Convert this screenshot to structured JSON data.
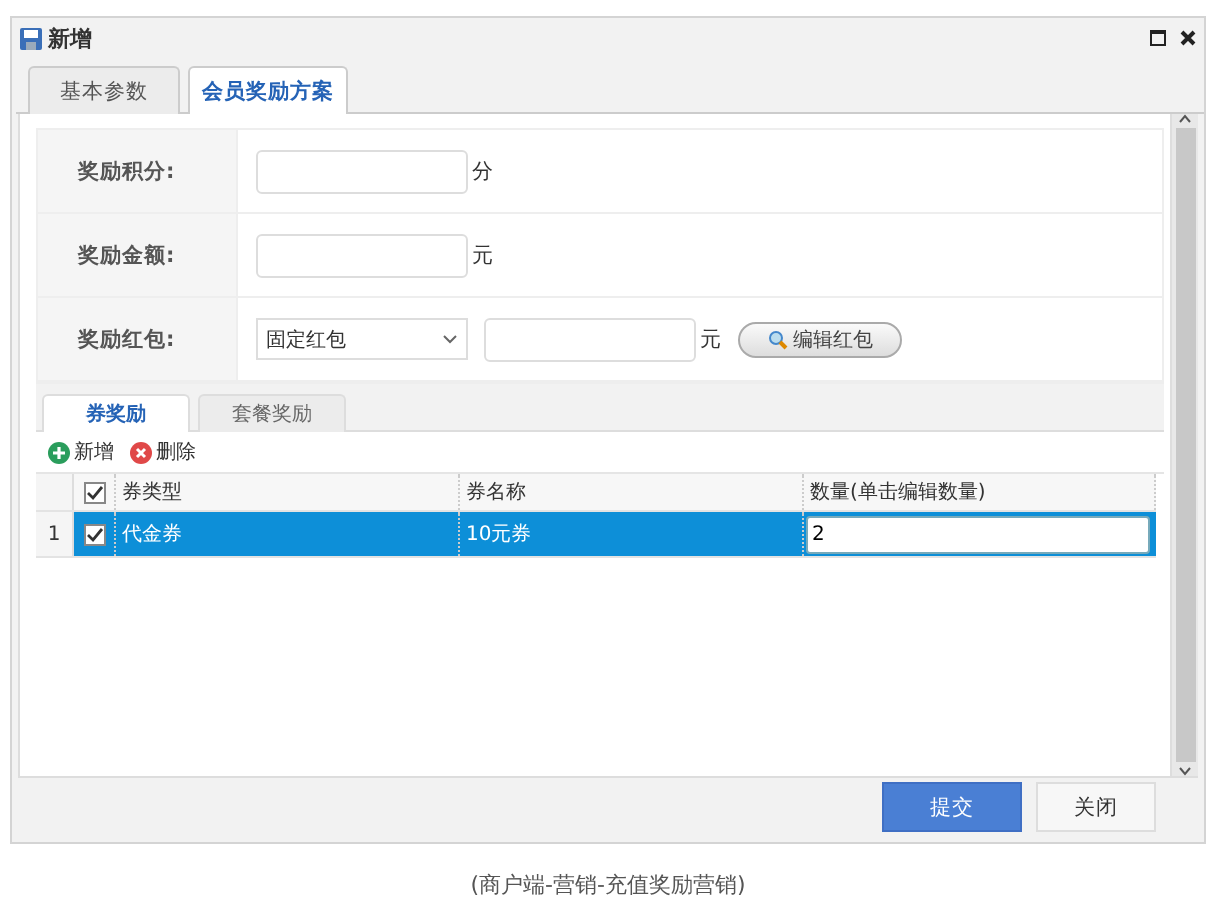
{
  "window": {
    "title": "新增"
  },
  "tabs": [
    {
      "label": "基本参数",
      "selected": false
    },
    {
      "label": "会员奖励方案",
      "selected": true
    }
  ],
  "form": [
    {
      "kind": "text",
      "label": "奖励积分:",
      "unit": "分"
    },
    {
      "kind": "text",
      "label": "奖励金额:",
      "unit": "元"
    },
    {
      "kind": "select",
      "label": "奖励红包:",
      "option": "固定红包",
      "unit": "元",
      "button": "编辑红包"
    }
  ],
  "sub_tabs": [
    {
      "label": "券奖励",
      "selected": true
    },
    {
      "label": "套餐奖励",
      "selected": false
    }
  ],
  "toolbar": [
    {
      "kind": "add",
      "label": "新增"
    },
    {
      "kind": "delete",
      "label": "删除"
    }
  ],
  "grid": {
    "header_checked": true,
    "columns": [
      "券类型",
      "券名称",
      "数量(单击编辑数量)"
    ],
    "rows": [
      {
        "number": "1",
        "selected": true,
        "checked": true,
        "type": "代金券",
        "name": "10元券",
        "quantity": "2"
      }
    ]
  },
  "buttons": [
    {
      "kind": "primary",
      "label": "提交"
    },
    {
      "kind": "default",
      "label": "关闭"
    }
  ],
  "caption": "(商户端-营销-充值奖励营销)"
}
